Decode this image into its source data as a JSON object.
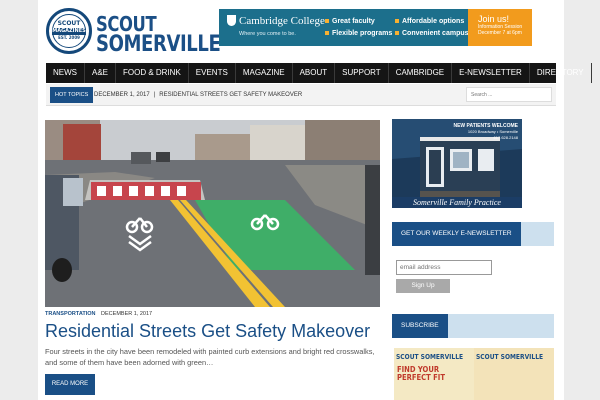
{
  "site": {
    "logo_top": "SCOUT",
    "logo_bottom": "SOMERVILLE",
    "seal_top": "SCOUT",
    "seal_mid": "MAGAZINES",
    "seal_bot": "EST. 2009"
  },
  "ad_banner": {
    "brand": "Cambridge College",
    "tagline": "Where you come to be.",
    "bullets": [
      "Great faculty",
      "Flexible programs",
      "Affordable options",
      "Convenient campuses"
    ],
    "cta_title": "Join us!",
    "cta_line1": "Information Session",
    "cta_line2": "December 7 at 6pm",
    "colors": {
      "teal": "#1c6f8c",
      "orange": "#f29b1d"
    }
  },
  "nav": {
    "items": [
      "NEWS",
      "A&E",
      "FOOD & DRINK",
      "EVENTS",
      "MAGAZINE",
      "ABOUT",
      "SUPPORT",
      "CAMBRIDGE",
      "E-NEWSLETTER",
      "DIRECTORY"
    ]
  },
  "hot_topics": {
    "label": "HOT TOPICS",
    "date": "DECEMBER 1, 2017",
    "separator": "|",
    "headline": "RESIDENTIAL STREETS GET SAFETY MAKEOVER",
    "search_placeholder": "Search ..."
  },
  "featured": {
    "category": "TRANSPORTATION",
    "date": "DECEMBER 1, 2017",
    "title": "Residential Streets Get Safety Makeover",
    "excerpt": "Four streets in the city have been remodeled with painted curb extensions and bright red crosswalks, and some of them have been adorned with green…",
    "read_more": "READ MORE",
    "image_icon": "street-photo"
  },
  "sidebar": {
    "ad": {
      "headline": "NEW PATIENTS WELCOME",
      "address": "1020 Broadway • Somerville",
      "phone": "617.628.2148",
      "name": "Somerville Family Practice"
    },
    "newsletter": {
      "heading": "GET OUR WEEKLY E-NEWSLETTER",
      "placeholder": "email address",
      "button": "Sign Up"
    },
    "subscribe": {
      "heading": "SUBSCRIBE",
      "covers": [
        {
          "title": "SCOUT SOMERVILLE",
          "label": "FIND YOUR PERFECT FIT"
        },
        {
          "title": "SCOUT SOMERVILLE",
          "label": ""
        }
      ]
    }
  },
  "colors": {
    "brand_blue": "#1a4f86",
    "nav_black": "#151515"
  }
}
